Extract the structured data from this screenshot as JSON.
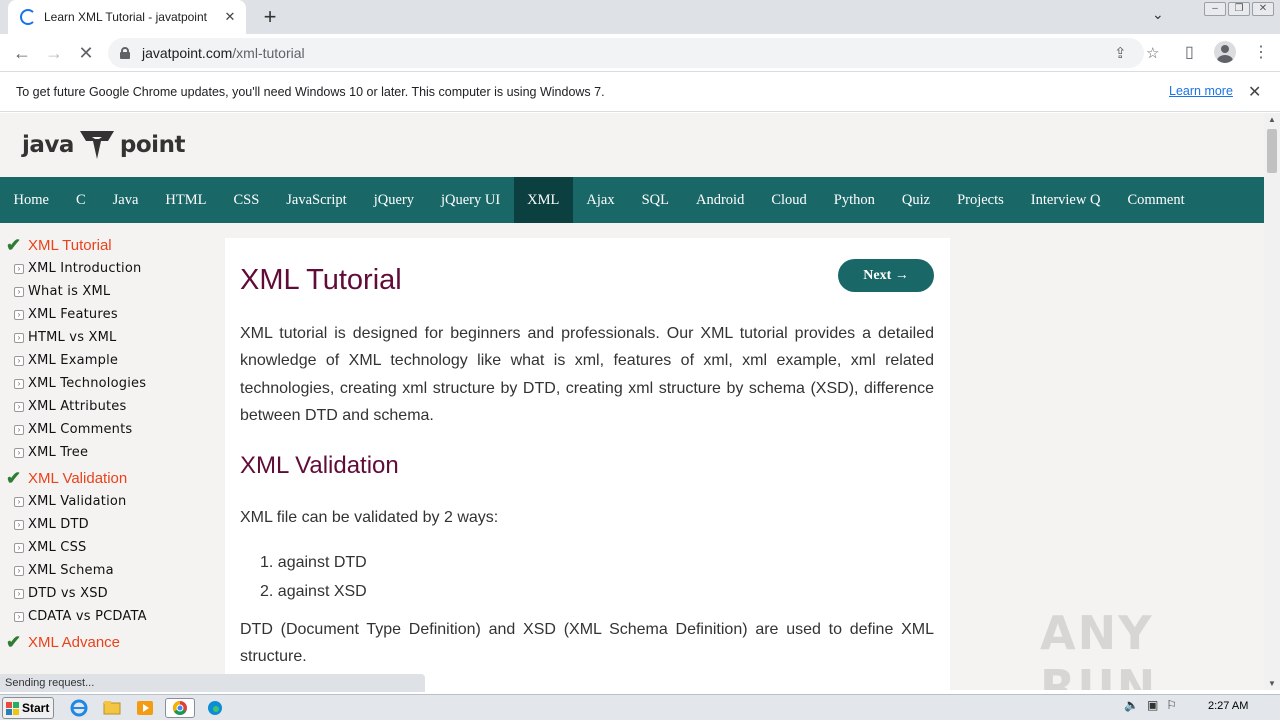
{
  "browser": {
    "tab_title": "Learn XML Tutorial - javatpoint",
    "url_host": "javatpoint.com",
    "url_path": "/xml-tutorial",
    "infobar_text": "To get future Google Chrome updates, you'll need Windows 10 or later. This computer is using Windows 7.",
    "infobar_link": "Learn more",
    "status_text": "Sending request..."
  },
  "site": {
    "logo_left": "java",
    "logo_right": "point",
    "nav": [
      "Home",
      "C",
      "Java",
      "HTML",
      "CSS",
      "JavaScript",
      "jQuery",
      "jQuery UI",
      "XML",
      "Ajax",
      "SQL",
      "Android",
      "Cloud",
      "Python",
      "Quiz",
      "Projects",
      "Interview Q",
      "Comment"
    ],
    "nav_active": "XML"
  },
  "sidebar": {
    "sections": [
      {
        "title": "XML Tutorial",
        "items": [
          "XML Introduction",
          "What is XML",
          "XML Features",
          "HTML vs XML",
          "XML Example",
          "XML Technologies",
          "XML Attributes",
          "XML Comments",
          "XML Tree"
        ]
      },
      {
        "title": "XML Validation",
        "items": [
          "XML Validation",
          "XML DTD",
          "XML CSS",
          "XML Schema",
          "DTD vs XSD",
          "CDATA vs PCDATA"
        ]
      },
      {
        "title": "XML Advance",
        "items": []
      }
    ]
  },
  "content": {
    "title": "XML Tutorial",
    "next_label": "Next →",
    "intro": "XML tutorial is designed for beginners and professionals. Our XML tutorial provides a detailed knowledge of XML technology like what is xml, features of xml, xml example, xml related technologies, creating xml structure by DTD, creating xml structure by schema (XSD), difference between DTD and schema.",
    "validation_heading": "XML Validation",
    "validation_intro": "XML file can be validated by 2 ways:",
    "validation_list": [
      "1. against DTD",
      "2. against XSD"
    ],
    "dtd_para": "DTD (Document Type Definition) and XSD (XML Schema Definition) are used to define XML structure."
  },
  "watermark": "ANY RUN",
  "taskbar": {
    "start_label": "Start",
    "clock": "2:27 AM"
  },
  "colors": {
    "nav_bg": "#1a6768",
    "nav_active_bg": "#0b3f40",
    "heading": "#610b38",
    "section_title": "#e8431c"
  }
}
